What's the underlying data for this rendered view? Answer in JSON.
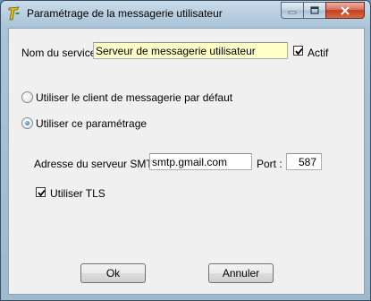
{
  "window": {
    "title": "Paramétrage de la messagerie utilisateur"
  },
  "service": {
    "label": "Nom du service :",
    "value": "Serveur de messagerie utilisateur",
    "actif_label": "Actif",
    "actif_checked": true
  },
  "mode": {
    "default_label": "Utiliser le client de messagerie par défaut",
    "custom_label": "Utiliser ce paramétrage",
    "selected": "custom"
  },
  "smtp": {
    "server_label": "Adresse du serveur SMTP :",
    "server_value": "smtp.gmail.com",
    "port_label": "Port :",
    "port_value": "587",
    "tls_label": "Utiliser TLS",
    "tls_checked": true
  },
  "buttons": {
    "ok": "Ok",
    "cancel": "Annuler"
  }
}
